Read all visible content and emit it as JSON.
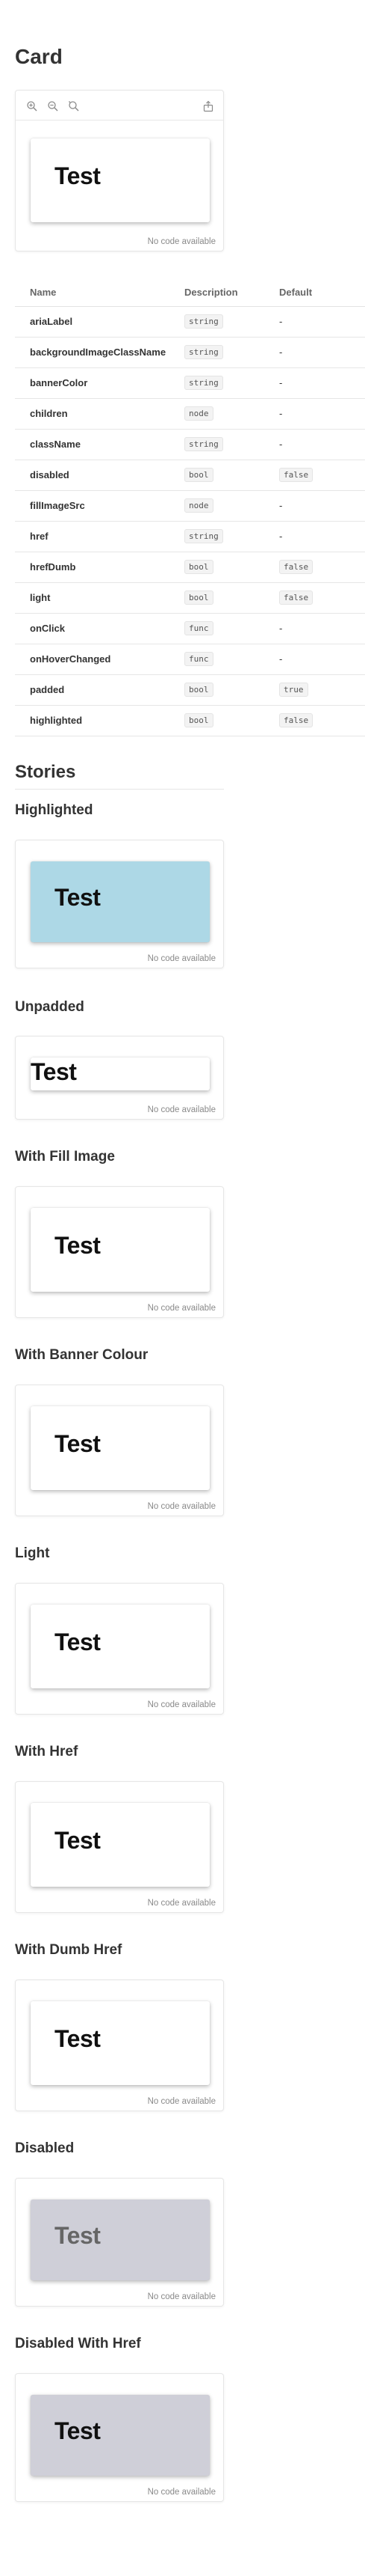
{
  "page": {
    "title": "Card"
  },
  "toolbar": {
    "zoom_in_icon": "zoom-in-icon",
    "zoom_out_icon": "zoom-out-icon",
    "zoom_reset_icon": "zoom-reset-icon",
    "share_icon": "share-icon"
  },
  "demo": {
    "card_text": "Test",
    "no_code": "No code available"
  },
  "props": {
    "headers": {
      "name": "Name",
      "description": "Description",
      "default": "Default"
    },
    "rows": [
      {
        "name": "ariaLabel",
        "type": "string",
        "default": "-"
      },
      {
        "name": "backgroundImageClassName",
        "type": "string",
        "default": "-"
      },
      {
        "name": "bannerColor",
        "type": "string",
        "default": "-"
      },
      {
        "name": "children",
        "type": "node",
        "default": "-"
      },
      {
        "name": "className",
        "type": "string",
        "default": "-"
      },
      {
        "name": "disabled",
        "type": "bool",
        "default": "false"
      },
      {
        "name": "fillImageSrc",
        "type": "node",
        "default": "-"
      },
      {
        "name": "href",
        "type": "string",
        "default": "-"
      },
      {
        "name": "hrefDumb",
        "type": "bool",
        "default": "false"
      },
      {
        "name": "light",
        "type": "bool",
        "default": "false"
      },
      {
        "name": "onClick",
        "type": "func",
        "default": "-"
      },
      {
        "name": "onHoverChanged",
        "type": "func",
        "default": "-"
      },
      {
        "name": "padded",
        "type": "bool",
        "default": "true"
      },
      {
        "name": "highlighted",
        "type": "bool",
        "default": "false"
      }
    ]
  },
  "stories": {
    "title": "Stories",
    "items": [
      {
        "title": "Highlighted",
        "card_text": "Test",
        "no_code": "No code available",
        "card_color": "#add8e6"
      },
      {
        "title": "Unpadded",
        "card_text": "Test",
        "no_code": "No code available",
        "card_color": "#ffffff"
      },
      {
        "title": "With Fill Image",
        "card_text": "Test",
        "no_code": "No code available",
        "card_color": "#ffffff"
      },
      {
        "title": "With Banner Colour",
        "card_text": "Test",
        "no_code": "No code available",
        "card_color": "#ffffff"
      },
      {
        "title": "Light",
        "card_text": "Test",
        "no_code": "No code available",
        "card_color": "#ffffff"
      },
      {
        "title": "With Href",
        "card_text": "Test",
        "no_code": "No code available",
        "card_color": "#ffffff"
      },
      {
        "title": "With Dumb Href",
        "card_text": "Test",
        "no_code": "No code available",
        "card_color": "#ffffff"
      },
      {
        "title": "Disabled",
        "card_text": "Test",
        "no_code": "No code available",
        "card_color": "#cfcfd8"
      },
      {
        "title": "Disabled With Href",
        "card_text": "Test",
        "no_code": "No code available",
        "card_color": "#cfcfd8"
      }
    ]
  }
}
